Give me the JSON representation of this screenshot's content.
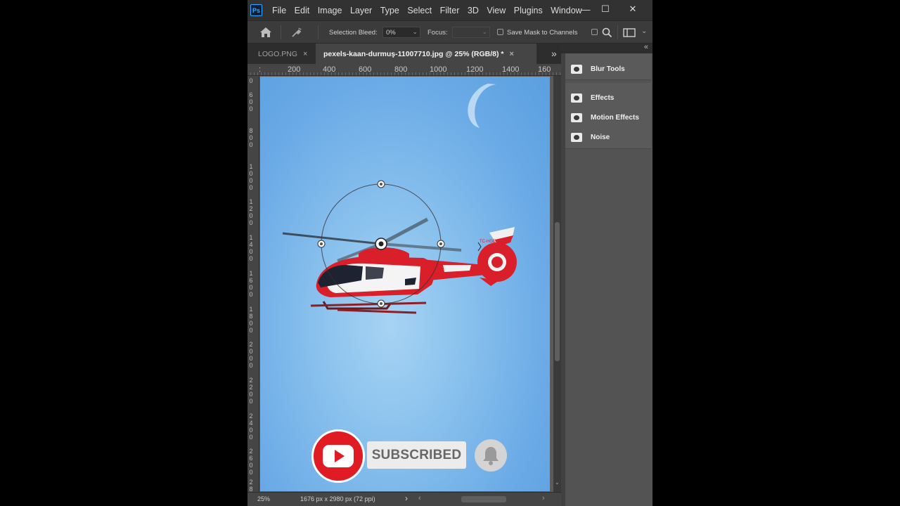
{
  "app": {
    "logo": "Ps",
    "menu": [
      "File",
      "Edit",
      "Image",
      "Layer",
      "Type",
      "Select",
      "Filter",
      "3D",
      "View",
      "Plugins",
      "Window"
    ]
  },
  "window_controls": {
    "minimize": "—",
    "maximize": "☐",
    "close": "✕"
  },
  "options_bar": {
    "selection_bleed_label": "Selection Bleed:",
    "selection_bleed_value": "0%",
    "focus_label": "Focus:",
    "focus_value": "",
    "save_mask_label": "Save Mask to Channels",
    "save_mask_checked": false,
    "high_quality_checked": false
  },
  "tabs": [
    {
      "label": "LOGO.PNG",
      "active": false,
      "close": "×"
    },
    {
      "label": "pexels-kaan-durmuş-11007710.jpg @ 25% (RGB/8) *",
      "active": true,
      "close": "×"
    }
  ],
  "tab_overflow": "»",
  "panel_collapse": "«",
  "ruler": {
    "top": [
      ":",
      "200",
      "400",
      "600",
      "800",
      "1000",
      "1200",
      "1400",
      "160"
    ],
    "left": [
      "0",
      "600",
      "800",
      "1000",
      "1200",
      "1400",
      "1600",
      "1800",
      "2000",
      "2200",
      "2400",
      "2600",
      "2800"
    ]
  },
  "status": {
    "zoom": "25%",
    "dimensions": "1676 px x 2980 px (72 ppi)",
    "arrow": "›",
    "scroll_left": "‹",
    "scroll_right": "›"
  },
  "panel": {
    "groups": [
      {
        "items": [
          "Blur Tools"
        ]
      },
      {
        "items": [
          "Effects",
          "Motion Effects",
          "Noise"
        ]
      }
    ]
  },
  "overlay": {
    "subscribed_label": "SUBSCRIBED",
    "youtube_icon": "youtube-play-icon",
    "bell_icon": "bell-icon"
  },
  "helicopter": {
    "registration": "TC-HGE"
  },
  "colors": {
    "sky": "#7bb8ec",
    "helicopter_red": "#d91f2a",
    "youtube_red": "#e01b24",
    "ps_blue": "#31a8ff"
  }
}
